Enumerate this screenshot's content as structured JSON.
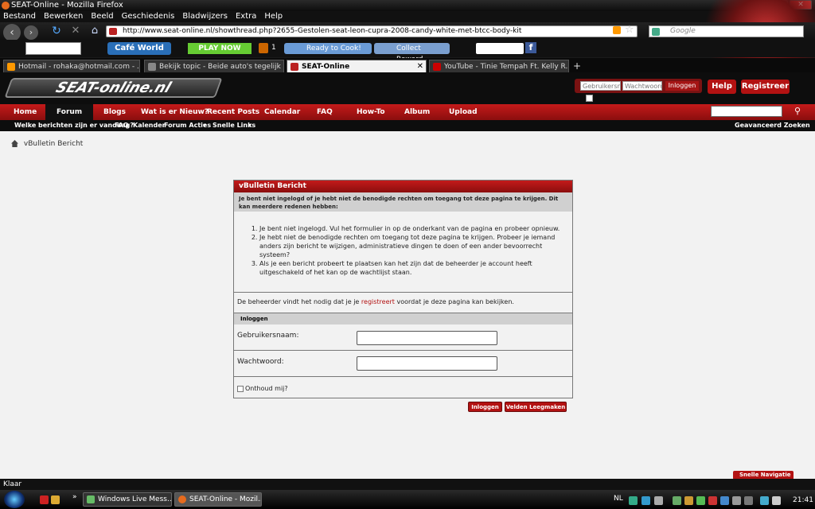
{
  "window": {
    "title": "SEAT-Online - Mozilla Firefox"
  },
  "menubar": [
    "Bestand",
    "Bewerken",
    "Beeld",
    "Geschiedenis",
    "Bladwijzers",
    "Extra",
    "Help"
  ],
  "browser": {
    "url": "http://www.seat-online.nl/showthread.php?2655-Gestolen-seat-leon-cupra-2008-candy-white-met-btcc-body-kit",
    "search_placeholder": "Google",
    "toolbar": {
      "cafe_world": "Café World",
      "play_now": "PLAY NOW",
      "count": "1",
      "ready_to_cook": "Ready to Cook!",
      "collect_reward": "Collect Reward"
    },
    "tabs": [
      {
        "label": "Hotmail - rohaka@hotmail.com - ...",
        "active": false
      },
      {
        "label": "Bekijk topic - Beide auto's tegelijk g...",
        "active": false
      },
      {
        "label": "SEAT-Online",
        "active": true
      },
      {
        "label": "YouTube - Tinie Tempah Ft. Kelly R...",
        "active": false
      }
    ]
  },
  "site": {
    "logo": "SEAT-online.nl",
    "login": {
      "username_placeholder": "Gebruikersnaa",
      "password_placeholder": "Wachtwoord",
      "button": "Inloggen"
    },
    "help": "Help",
    "register": "Registreer",
    "nav": [
      "Home",
      "Forum",
      "Blogs",
      "Wat is er Nieuw?",
      "Recent Posts",
      "Calendar",
      "FAQ",
      "How-To",
      "Album",
      "Upload"
    ],
    "subnav": [
      "Welke berichten zijn er vandaag?",
      "FAQ",
      "Kalender",
      "Forum Acties",
      "Snelle Links"
    ],
    "advanced_search": "Geavanceerd Zoeken",
    "breadcrumb": "vBulletin Bericht"
  },
  "message": {
    "title": "vBulletin Bericht",
    "note": "Je bent niet ingelogd of je hebt niet de benodigde rechten om toegang tot deze pagina te krijgen. Dit kan meerdere redenen hebben:",
    "reasons": [
      "Je bent niet ingelogd. Vul het formulier in op de onderkant van de pagina en probeer opnieuw.",
      "Je hebt niet de benodigde rechten om toegang tot deze pagina te krijgen. Probeer je iemand anders zijn bericht te wijzigen, administratieve dingen te doen of een ander bevoorrecht systeem?",
      "Als je een bericht probeert te plaatsen kan het zijn dat de beheerder je account heeft uitgeschakeld of het kan op de wachtlijst staan."
    ],
    "register_pre": "De beheerder vindt het nodig dat je je ",
    "register_link": "registreert",
    "register_post": " voordat je deze pagina kan bekijken.",
    "login_header": "Inloggen",
    "username_label": "Gebruikersnaam:",
    "password_label": "Wachtwoord:",
    "remember": "Onthoud mij?",
    "login_button": "Inloggen",
    "clear_button": "Velden Leegmaken"
  },
  "quick_nav": "Snelle Navigatie",
  "status": "Klaar",
  "taskbar": {
    "tasks": [
      "Windows Live Mess...",
      "SEAT-Online - Mozil..."
    ],
    "lang": "NL",
    "clock": "21:41"
  }
}
